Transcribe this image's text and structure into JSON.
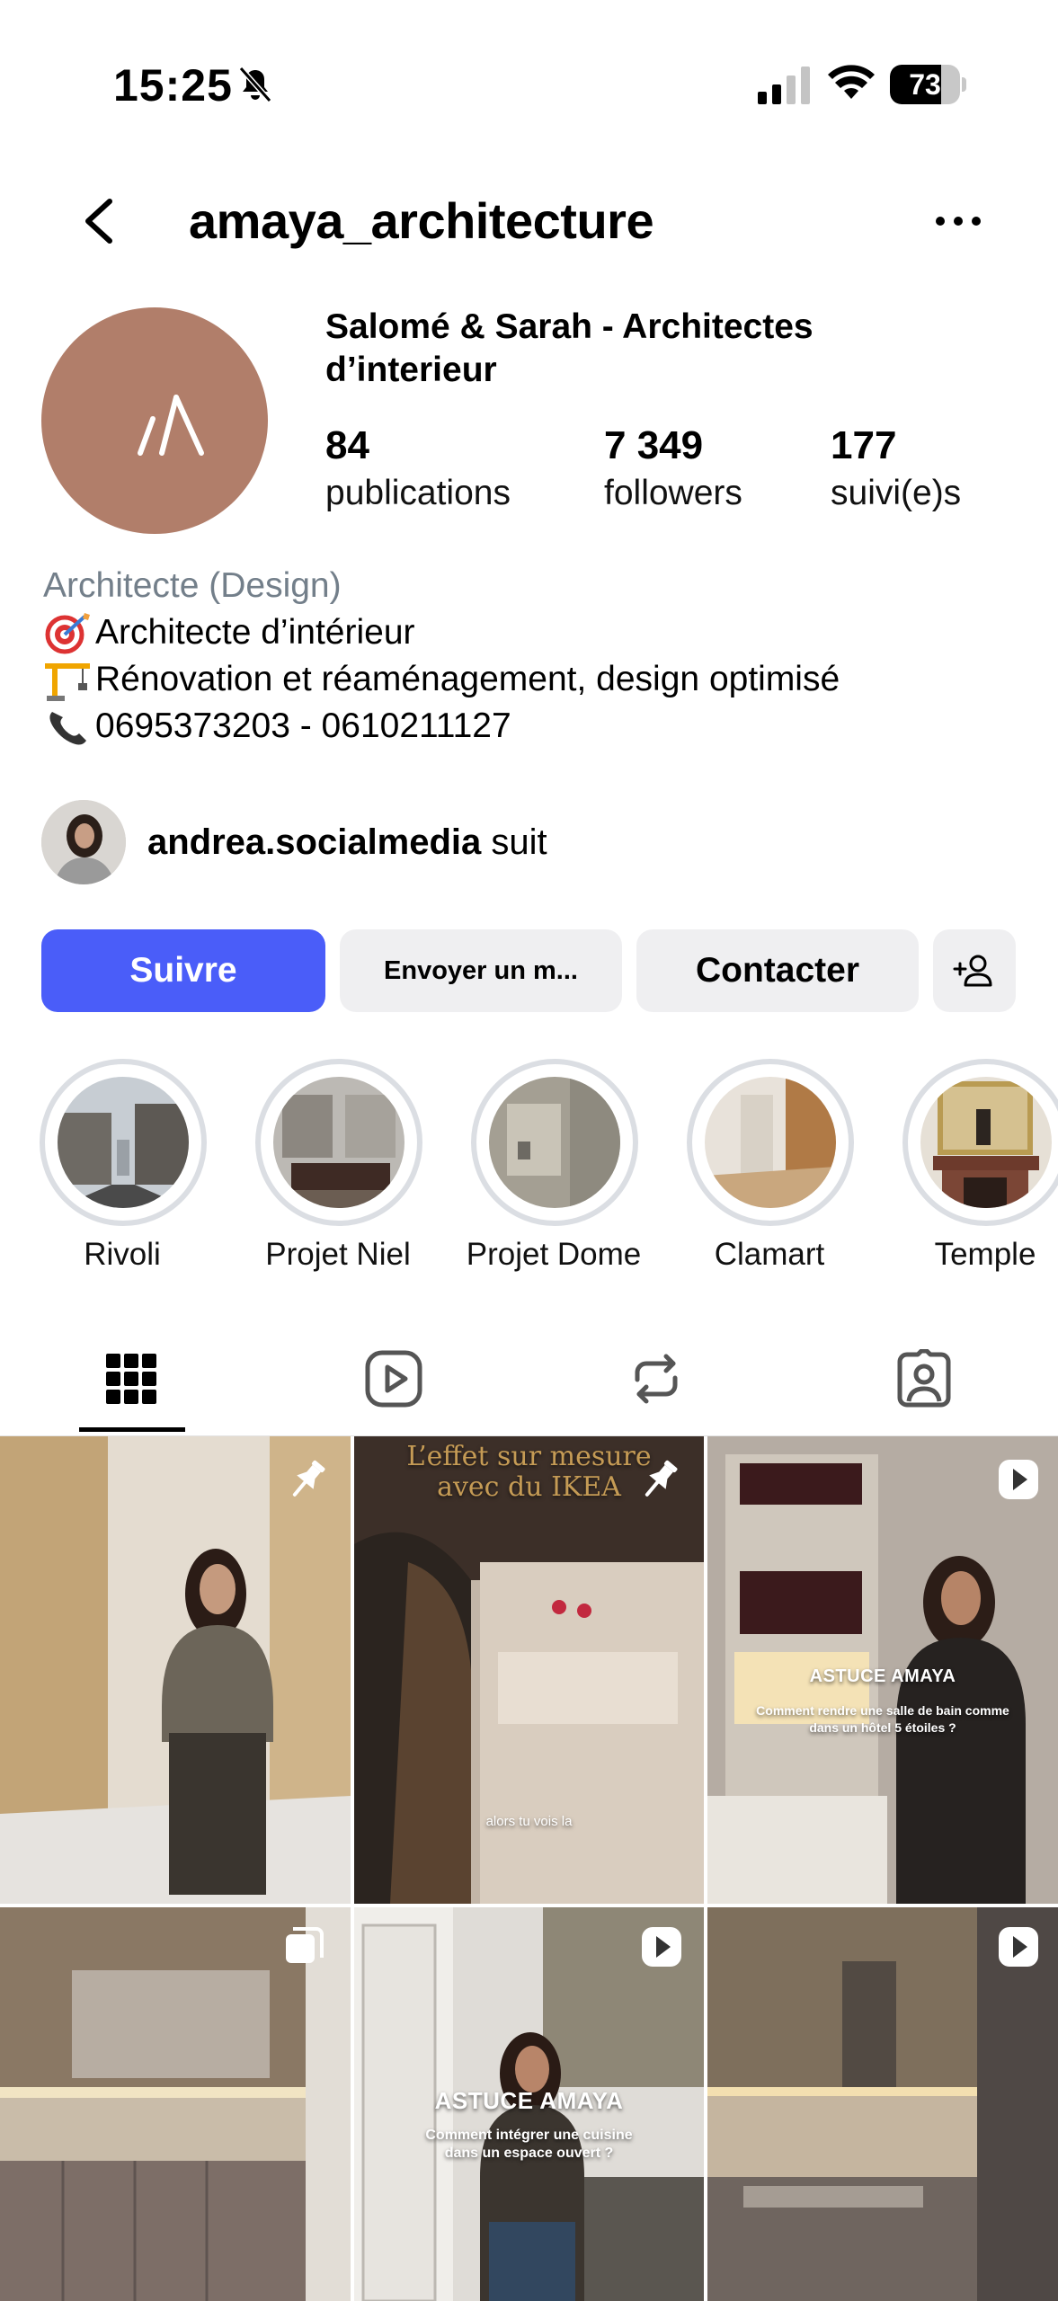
{
  "status_bar": {
    "time": "15:25",
    "battery": "73",
    "battery_level": 0.73
  },
  "header": {
    "username": "amaya_architecture"
  },
  "profile": {
    "name": "Salomé & Sarah - Architectes d’interieur",
    "stats": [
      {
        "value": "84",
        "label": "publications"
      },
      {
        "value": "7 349",
        "label": "followers"
      },
      {
        "value": "177",
        "label": "suivi(e)s"
      }
    ],
    "category": "Architecte (Design)",
    "bio": [
      {
        "icon": "target-icon",
        "text": "Architecte d’intérieur"
      },
      {
        "icon": "crane-icon",
        "text": "Rénovation et réaménagement, design optimisé"
      },
      {
        "icon": "phone-icon",
        "text": "0695373203 - 0610211127"
      }
    ]
  },
  "followed_by": {
    "username": "andrea.socialmedia",
    "suffix": " suit"
  },
  "buttons": {
    "follow": "Suivre",
    "message": "Envoyer un m...",
    "contact": "Contacter"
  },
  "highlights": [
    {
      "label": "Rivoli"
    },
    {
      "label": "Projet Niel"
    },
    {
      "label": "Projet Dome"
    },
    {
      "label": "Clamart"
    },
    {
      "label": "Temple"
    }
  ],
  "tabs": [
    {
      "name": "grid-icon",
      "active": true
    },
    {
      "name": "reels-icon",
      "active": false
    },
    {
      "name": "reposts-icon",
      "active": false
    },
    {
      "name": "tagged-icon",
      "active": false
    }
  ],
  "posts": [
    {
      "type": "pinned",
      "overlay_title": "",
      "overlay_text": ""
    },
    {
      "type": "pinned",
      "overlay_title": "L’effet sur mesure avec du IKEA",
      "overlay_text": "alors tu vois la"
    },
    {
      "type": "reel",
      "overlay_title": "ASTUCE AMAYA",
      "overlay_text": "Comment rendre une salle de bain comme dans un hôtel 5 étoiles ?"
    },
    {
      "type": "carousel",
      "overlay_title": "",
      "overlay_text": ""
    },
    {
      "type": "reel",
      "overlay_title": "ASTUCE AMAYA",
      "overlay_text": "Comment intégrer une cuisine dans un espace ouvert ?"
    },
    {
      "type": "reel",
      "overlay_title": "",
      "overlay_text": ""
    }
  ]
}
